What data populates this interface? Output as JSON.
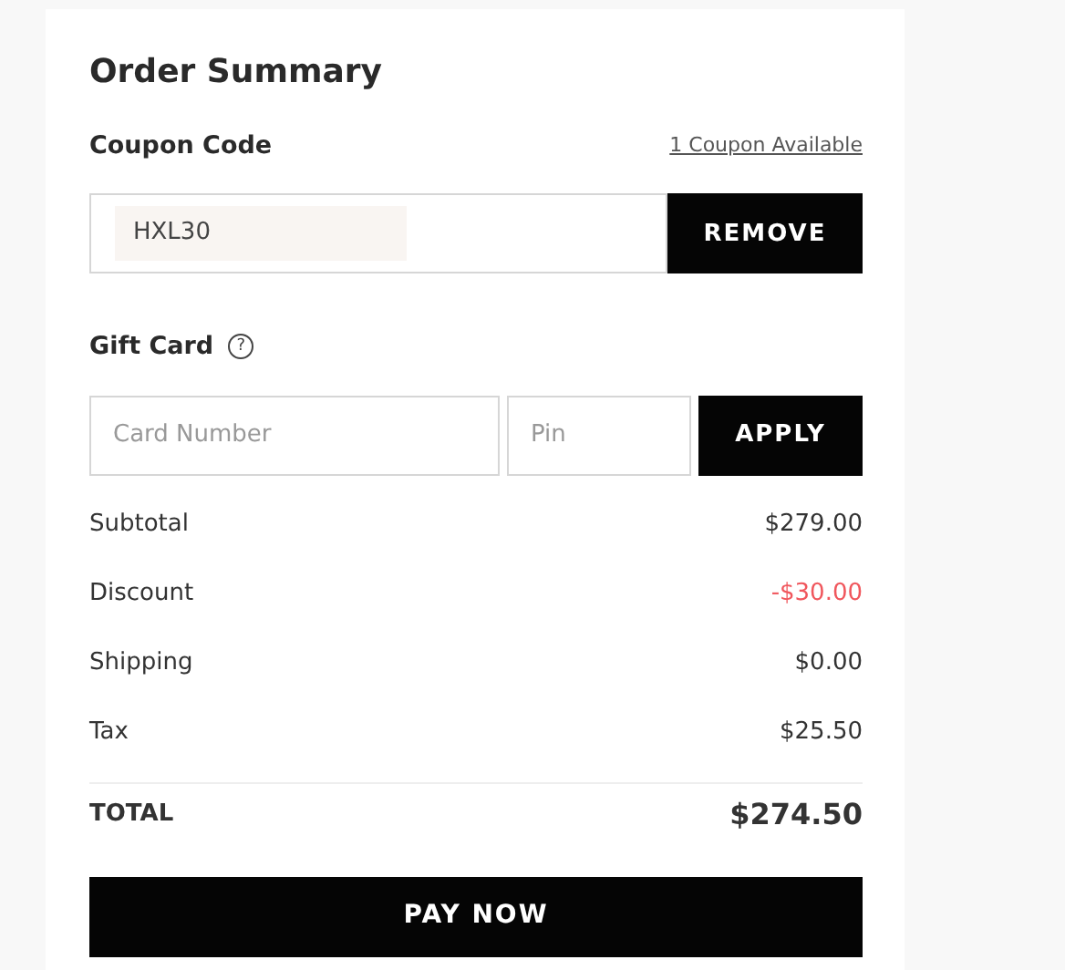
{
  "title": "Order Summary",
  "coupon": {
    "label": "Coupon Code",
    "link": "1 Coupon Available",
    "code": "HXL30",
    "button": "REMOVE"
  },
  "gift_card": {
    "label": "Gift Card",
    "help_icon": "?",
    "card_placeholder": "Card Number",
    "pin_placeholder": "Pin",
    "button": "APPLY"
  },
  "lines": [
    {
      "label": "Subtotal",
      "amount": "$279.00",
      "kind": "normal"
    },
    {
      "label": "Discount",
      "amount": "-$30.00",
      "kind": "discount"
    },
    {
      "label": "Shipping",
      "amount": "$0.00",
      "kind": "normal"
    },
    {
      "label": "Tax",
      "amount": "$25.50",
      "kind": "normal"
    }
  ],
  "total": {
    "label": "TOTAL",
    "amount": "$274.50"
  },
  "pay_button": "PAY NOW"
}
